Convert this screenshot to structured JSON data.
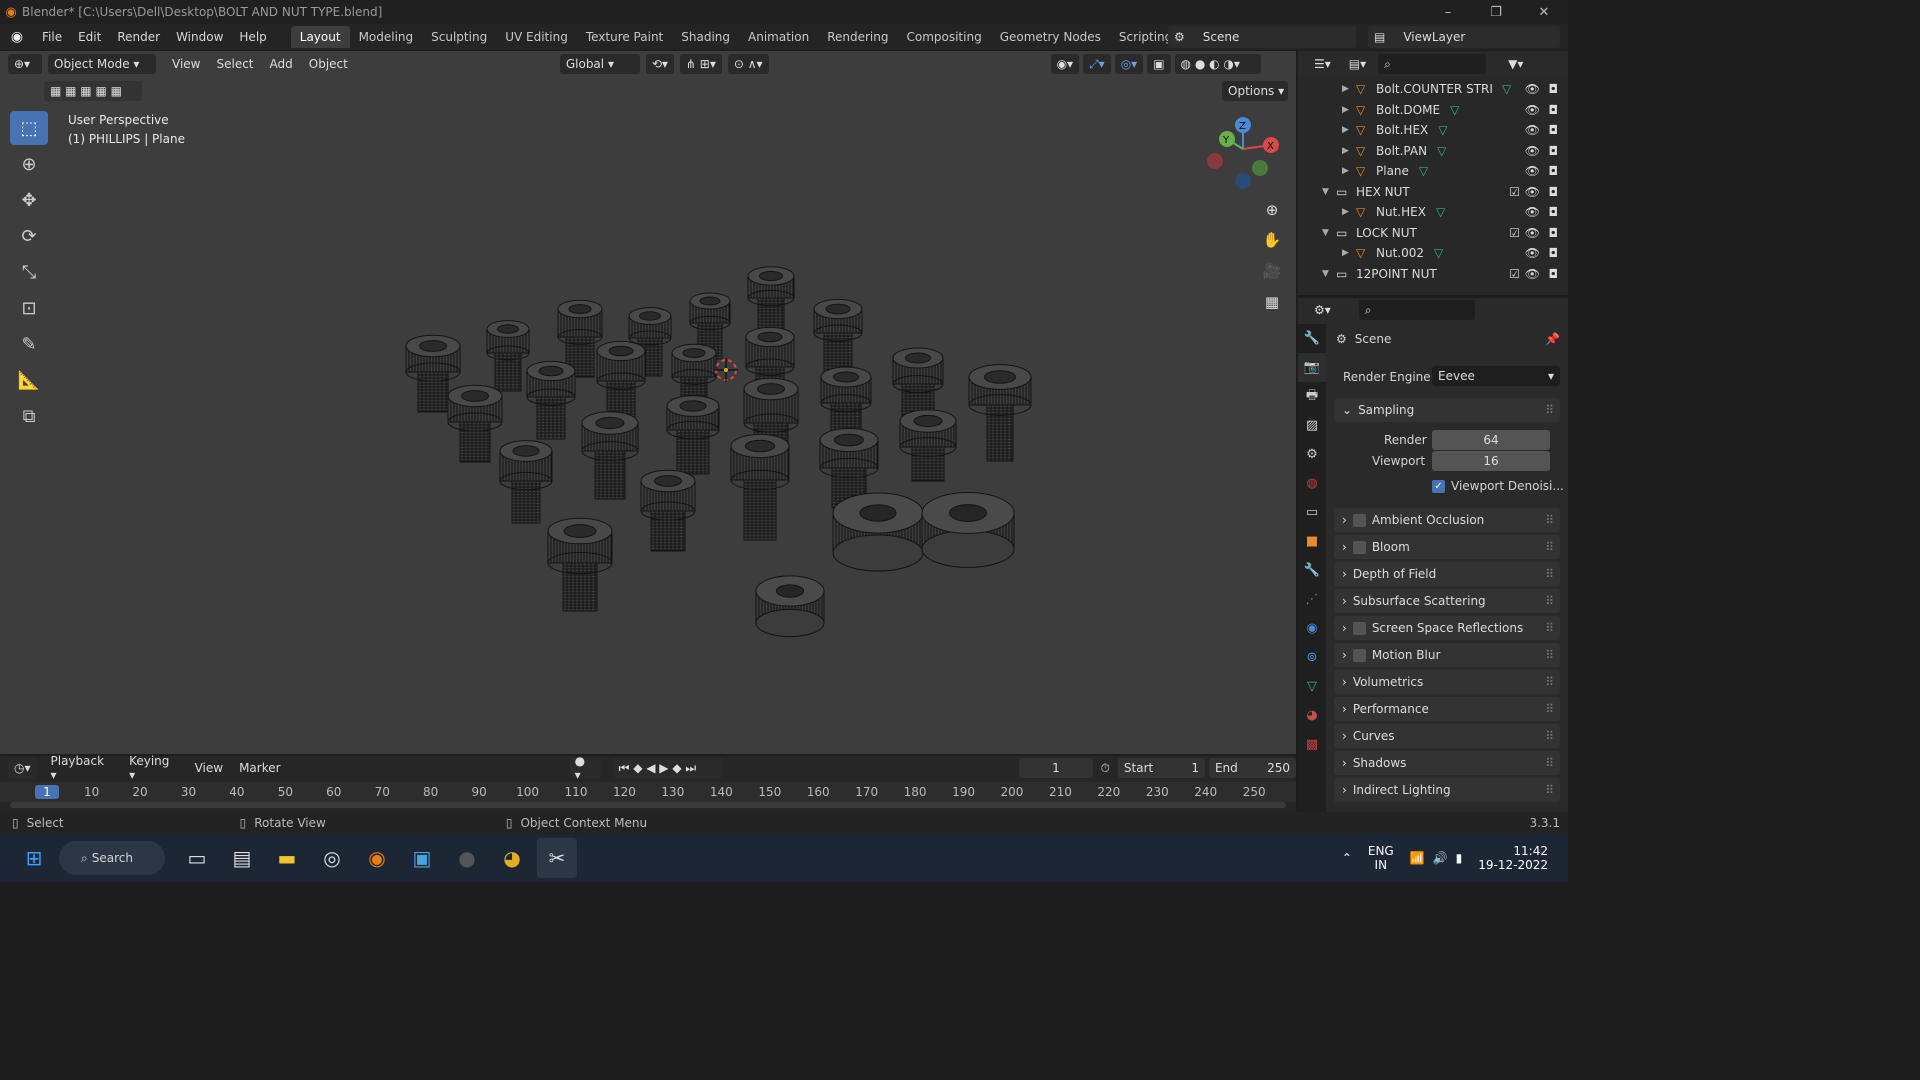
{
  "window": {
    "title": "Blender* [C:\\Users\\Dell\\Desktop\\BOLT AND NUT TYPE.blend]",
    "minimize": "–",
    "maximize": "❐",
    "close": "✕"
  },
  "menu": [
    "File",
    "Edit",
    "Render",
    "Window",
    "Help"
  ],
  "workspaces": [
    "Layout",
    "Modeling",
    "Sculpting",
    "UV Editing",
    "Texture Paint",
    "Shading",
    "Animation",
    "Rendering",
    "Compositing",
    "Geometry Nodes",
    "Scripting",
    "+"
  ],
  "active_workspace": "Layout",
  "scene": {
    "name": "Scene",
    "view_layer": "ViewLayer"
  },
  "viewport": {
    "mode": "Object Mode",
    "menus": [
      "View",
      "Select",
      "Add",
      "Object"
    ],
    "orientation": "Global",
    "options_label": "Options",
    "perspective": "User Perspective",
    "object_info": "(1) PHILLIPS | Plane",
    "gizmo": {
      "z": "Z",
      "y": "Y",
      "x": "X"
    }
  },
  "outliner": {
    "rows": [
      {
        "label": "Bolt.COUNTER STRIKE",
        "type": "mesh",
        "indent": 1
      },
      {
        "label": "Bolt.DOME",
        "type": "mesh",
        "indent": 1
      },
      {
        "label": "Bolt.HEX",
        "type": "mesh",
        "indent": 1
      },
      {
        "label": "Bolt.PAN",
        "type": "mesh",
        "indent": 1
      },
      {
        "label": "Plane",
        "type": "mesh",
        "indent": 1
      },
      {
        "label": "HEX NUT",
        "type": "collection",
        "indent": 0
      },
      {
        "label": "Nut.HEX",
        "type": "mesh",
        "indent": 1
      },
      {
        "label": "LOCK NUT",
        "type": "collection",
        "indent": 0
      },
      {
        "label": "Nut.002",
        "type": "mesh",
        "indent": 1
      },
      {
        "label": "12POINT NUT",
        "type": "collection",
        "indent": 0
      }
    ]
  },
  "properties": {
    "context": "Scene",
    "render_engine_label": "Render Engine",
    "render_engine": "Eevee",
    "sampling_label": "Sampling",
    "render_label": "Render",
    "render_samples": "64",
    "viewport_label": "Viewport",
    "viewport_samples": "16",
    "denoise_label": "Viewport Denoisi...",
    "panels": [
      {
        "label": "Ambient Occlusion",
        "checkbox": true
      },
      {
        "label": "Bloom",
        "checkbox": true
      },
      {
        "label": "Depth of Field",
        "checkbox": false
      },
      {
        "label": "Subsurface Scattering",
        "checkbox": false
      },
      {
        "label": "Screen Space Reflections",
        "checkbox": true
      },
      {
        "label": "Motion Blur",
        "checkbox": true
      },
      {
        "label": "Volumetrics",
        "checkbox": false
      },
      {
        "label": "Performance",
        "checkbox": false
      },
      {
        "label": "Curves",
        "checkbox": false
      },
      {
        "label": "Shadows",
        "checkbox": false
      },
      {
        "label": "Indirect Lighting",
        "checkbox": false
      }
    ]
  },
  "timeline": {
    "menus": [
      "Playback",
      "Keying",
      "View",
      "Marker"
    ],
    "current_frame": "1",
    "start_label": "Start",
    "start": "1",
    "end_label": "End",
    "end": "250",
    "ticks": [
      "1",
      "10",
      "20",
      "30",
      "40",
      "50",
      "60",
      "70",
      "80",
      "90",
      "100",
      "110",
      "120",
      "130",
      "140",
      "150",
      "160",
      "170",
      "180",
      "190",
      "200",
      "210",
      "220",
      "230",
      "240",
      "250"
    ]
  },
  "status": {
    "select": "Select",
    "rotate": "Rotate View",
    "context_menu": "Object Context Menu",
    "version": "3.3.1"
  },
  "taskbar": {
    "search": "Search",
    "lang": "ENG",
    "region": "IN",
    "time": "11:42",
    "date": "19-12-2022"
  }
}
